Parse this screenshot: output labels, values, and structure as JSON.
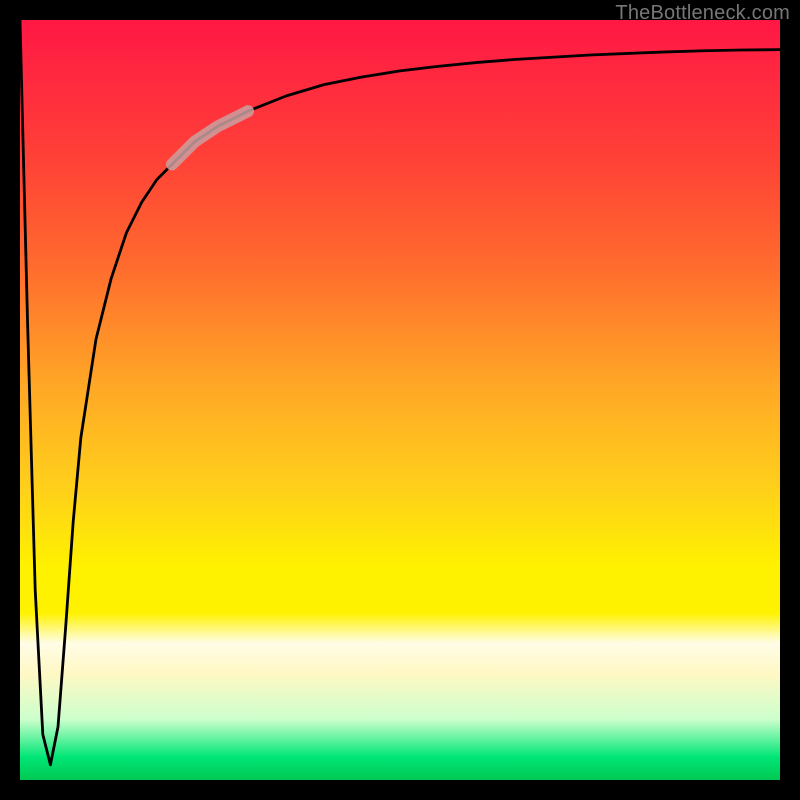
{
  "watermark": "TheBottleneck.com",
  "chart_data": {
    "type": "line",
    "title": "",
    "xlabel": "",
    "ylabel": "",
    "xlim": [
      0,
      100
    ],
    "ylim": [
      0,
      100
    ],
    "grid": false,
    "legend": false,
    "annotations": [],
    "series": [
      {
        "name": "bottleneck-curve",
        "x": [
          0,
          1,
          2,
          3,
          4,
          5,
          6,
          7,
          8,
          10,
          12,
          14,
          16,
          18,
          20,
          23,
          26,
          30,
          35,
          40,
          45,
          50,
          55,
          60,
          65,
          70,
          75,
          80,
          85,
          90,
          95,
          100
        ],
        "y": [
          100,
          60,
          25,
          6,
          2,
          7,
          20,
          34,
          45,
          58,
          66,
          72,
          76,
          79,
          81,
          84,
          86,
          88,
          90,
          91.5,
          92.5,
          93.3,
          93.9,
          94.4,
          94.8,
          95.1,
          95.4,
          95.6,
          95.8,
          95.95,
          96.05,
          96.1
        ]
      },
      {
        "name": "highlight-segment",
        "x": [
          20,
          23,
          26,
          30
        ],
        "y": [
          81,
          84,
          86,
          88
        ]
      }
    ],
    "gradient_stops": [
      {
        "pos": 0.0,
        "color": "#ff1744"
      },
      {
        "pos": 0.08,
        "color": "#ff2a3f"
      },
      {
        "pos": 0.18,
        "color": "#ff4037"
      },
      {
        "pos": 0.32,
        "color": "#ff6a2e"
      },
      {
        "pos": 0.48,
        "color": "#ffa726"
      },
      {
        "pos": 0.62,
        "color": "#ffd11a"
      },
      {
        "pos": 0.72,
        "color": "#fff200"
      },
      {
        "pos": 0.78,
        "color": "#fff200"
      },
      {
        "pos": 0.82,
        "color": "#fffde7"
      },
      {
        "pos": 0.86,
        "color": "#fff8c4"
      },
      {
        "pos": 0.92,
        "color": "#ccffcc"
      },
      {
        "pos": 0.97,
        "color": "#00e676"
      },
      {
        "pos": 1.0,
        "color": "#00c853"
      }
    ]
  }
}
